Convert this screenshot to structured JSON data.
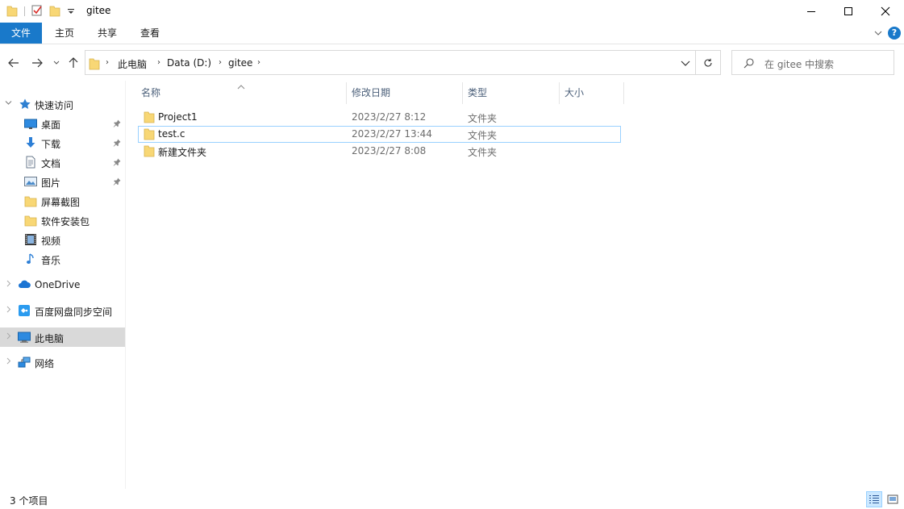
{
  "window": {
    "title": "gitee"
  },
  "ribbon": {
    "tabs": [
      {
        "label": "文件"
      },
      {
        "label": "主页"
      },
      {
        "label": "共享"
      },
      {
        "label": "查看"
      }
    ],
    "help": "?"
  },
  "address": {
    "crumbs": [
      "此电脑",
      "Data (D:)",
      "gitee"
    ]
  },
  "search": {
    "placeholder": "在 gitee 中搜索"
  },
  "nav": {
    "quick_access": "快速访问",
    "quick_items": [
      {
        "label": "桌面",
        "icon": "desktop-icon",
        "pinned": true
      },
      {
        "label": "下载",
        "icon": "download-icon",
        "pinned": true
      },
      {
        "label": "文档",
        "icon": "document-icon",
        "pinned": true
      },
      {
        "label": "图片",
        "icon": "picture-icon",
        "pinned": true
      },
      {
        "label": "屏幕截图",
        "icon": "folder-icon",
        "pinned": false
      },
      {
        "label": "软件安装包",
        "icon": "folder-icon",
        "pinned": false
      },
      {
        "label": "视频",
        "icon": "video-icon",
        "pinned": false
      },
      {
        "label": "音乐",
        "icon": "music-icon",
        "pinned": false
      }
    ],
    "onedrive": "OneDrive",
    "baidu": "百度网盘同步空间",
    "this_pc": "此电脑",
    "network": "网络"
  },
  "columns": [
    "名称",
    "修改日期",
    "类型",
    "大小"
  ],
  "files": [
    {
      "name": "Project1",
      "date": "2023/2/27 8:12",
      "type": "文件夹",
      "size": ""
    },
    {
      "name": "test.c",
      "date": "2023/2/27 13:44",
      "type": "文件夹",
      "size": ""
    },
    {
      "name": "新建文件夹",
      "date": "2023/2/27 8:08",
      "type": "文件夹",
      "size": ""
    }
  ],
  "status": {
    "count": "3 个项目"
  },
  "colors": {
    "accent": "#1979ca",
    "folder": "#f8d775",
    "selected_nav": "#d9d9d9",
    "focus_border": "#99d1ff"
  }
}
